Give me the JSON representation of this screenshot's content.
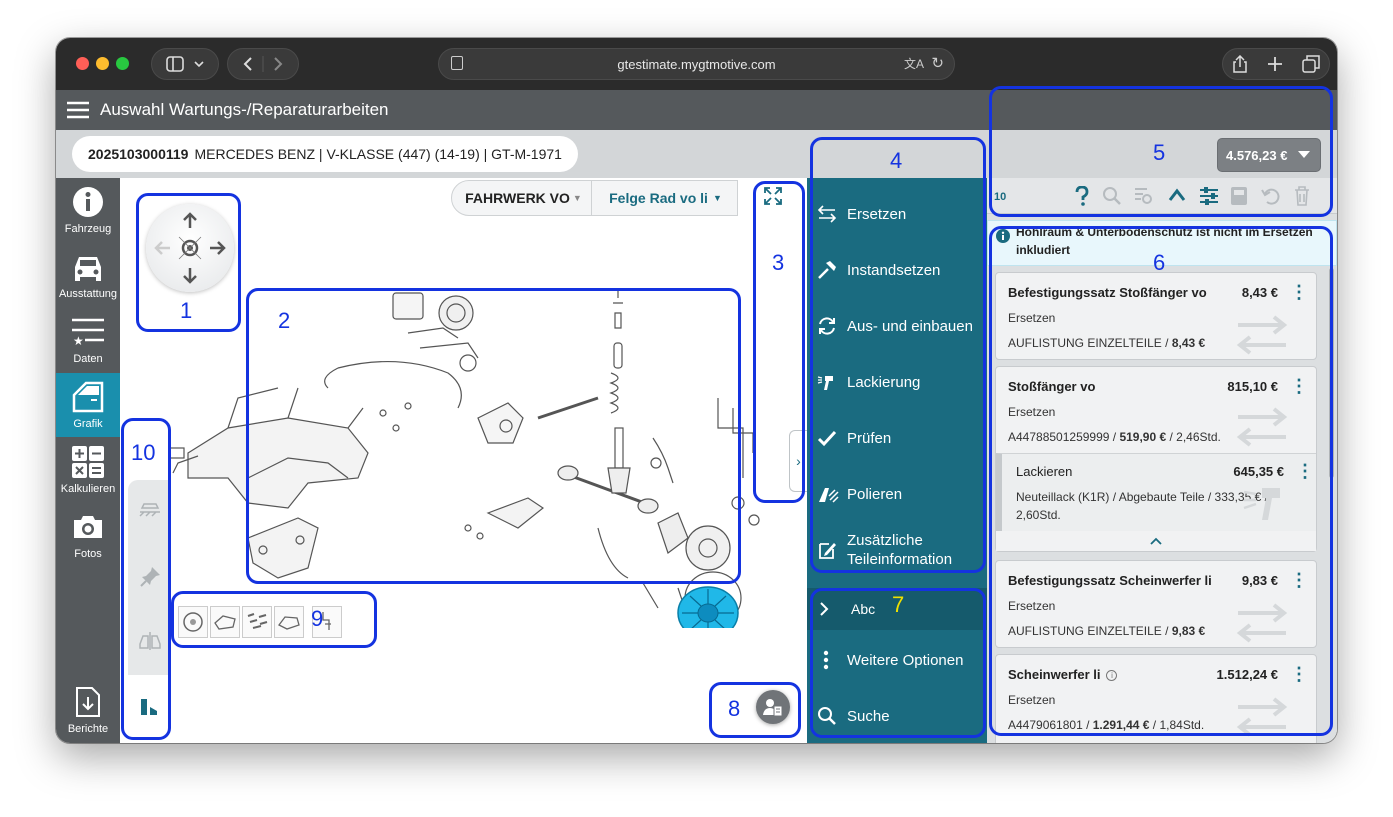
{
  "browser": {
    "url": "gtestimate.mygtmotive.com"
  },
  "app": {
    "title": "Auswahl Wartungs-/Reparaturarbeiten"
  },
  "vehicle": {
    "id": "2025103000119",
    "desc": "MERCEDES BENZ | V-KLASSE (447) (14-19) | GT-M-1971"
  },
  "total": {
    "amount": "4.576,23 €"
  },
  "leftnav": [
    {
      "label": "Fahrzeug",
      "icon": "info-icon"
    },
    {
      "label": "Ausstattung",
      "icon": "car-icon"
    },
    {
      "label": "Daten",
      "icon": "data-list-icon"
    },
    {
      "label": "Grafik",
      "icon": "car-door-icon"
    },
    {
      "label": "Kalkulieren",
      "icon": "calculator-icon"
    },
    {
      "label": "Fotos",
      "icon": "camera-icon"
    },
    {
      "label": "Berichte",
      "icon": "report-download-icon"
    }
  ],
  "canvas": {
    "group_select": "FAHRWERK VO",
    "part_select": "Felge Rad vo li"
  },
  "actions": [
    {
      "label": "Ersetzen",
      "icon": "swap-arrows-icon"
    },
    {
      "label": "Instandsetzen",
      "icon": "hammer-icon"
    },
    {
      "label": "Aus- und einbauen",
      "icon": "refresh-icon"
    },
    {
      "label": "Lackierung",
      "icon": "spray-gun-icon"
    },
    {
      "label": "Prüfen",
      "icon": "check-icon"
    },
    {
      "label": "Polieren",
      "icon": "polish-icon"
    },
    {
      "label": "Zusätzliche",
      "label2": "Teileinformation",
      "icon": "edit-note-icon"
    }
  ],
  "search_group": {
    "abc": "Abc",
    "more": "Weitere Optionen",
    "search": "Suche"
  },
  "toolbar": {
    "count": "10"
  },
  "notice": {
    "line1": "Hohlraum & Unterbodenschutz ist nicht im Ersetzen",
    "line2": "inkludiert"
  },
  "items": [
    {
      "title": "Befestigungssatz Stoßfänger vo",
      "price": "8,43 €",
      "op": "Ersetzen",
      "detail_prefix": "AUFLISTUNG EINZELTEILE / ",
      "detail_bold": "8,43 €",
      "detail_suffix": ""
    },
    {
      "title": "Stoßfänger vo",
      "price": "815,10 €",
      "op": "Ersetzen",
      "detail_prefix": "A44788501259999 / ",
      "detail_bold": "519,90 €",
      "detail_suffix": " / 2,46Std.",
      "sub": {
        "title": "Lackieren",
        "price": "645,35 €",
        "line1": "Neuteillack (K1R) / Abgebaute Teile / 333,35 € /",
        "line2": "2,60Std."
      }
    },
    {
      "title": "Befestigungssatz Scheinwerfer li",
      "price": "9,83 €",
      "op": "Ersetzen",
      "detail_prefix": "AUFLISTUNG EINZELTEILE / ",
      "detail_bold": "9,83 €",
      "detail_suffix": ""
    },
    {
      "title": "Scheinwerfer li",
      "price": "1.512,24 €",
      "op": "Ersetzen",
      "detail_prefix": "A4479061801 / ",
      "detail_bold": "1.291,44 €",
      "detail_suffix": " / 1,84Std."
    }
  ],
  "annotations": [
    "1",
    "2",
    "3",
    "4",
    "5",
    "6",
    "7",
    "8",
    "9",
    "10"
  ],
  "colors": {
    "teal": "#1a6b80",
    "annotation": "#1433e0",
    "header": "#55595c"
  }
}
